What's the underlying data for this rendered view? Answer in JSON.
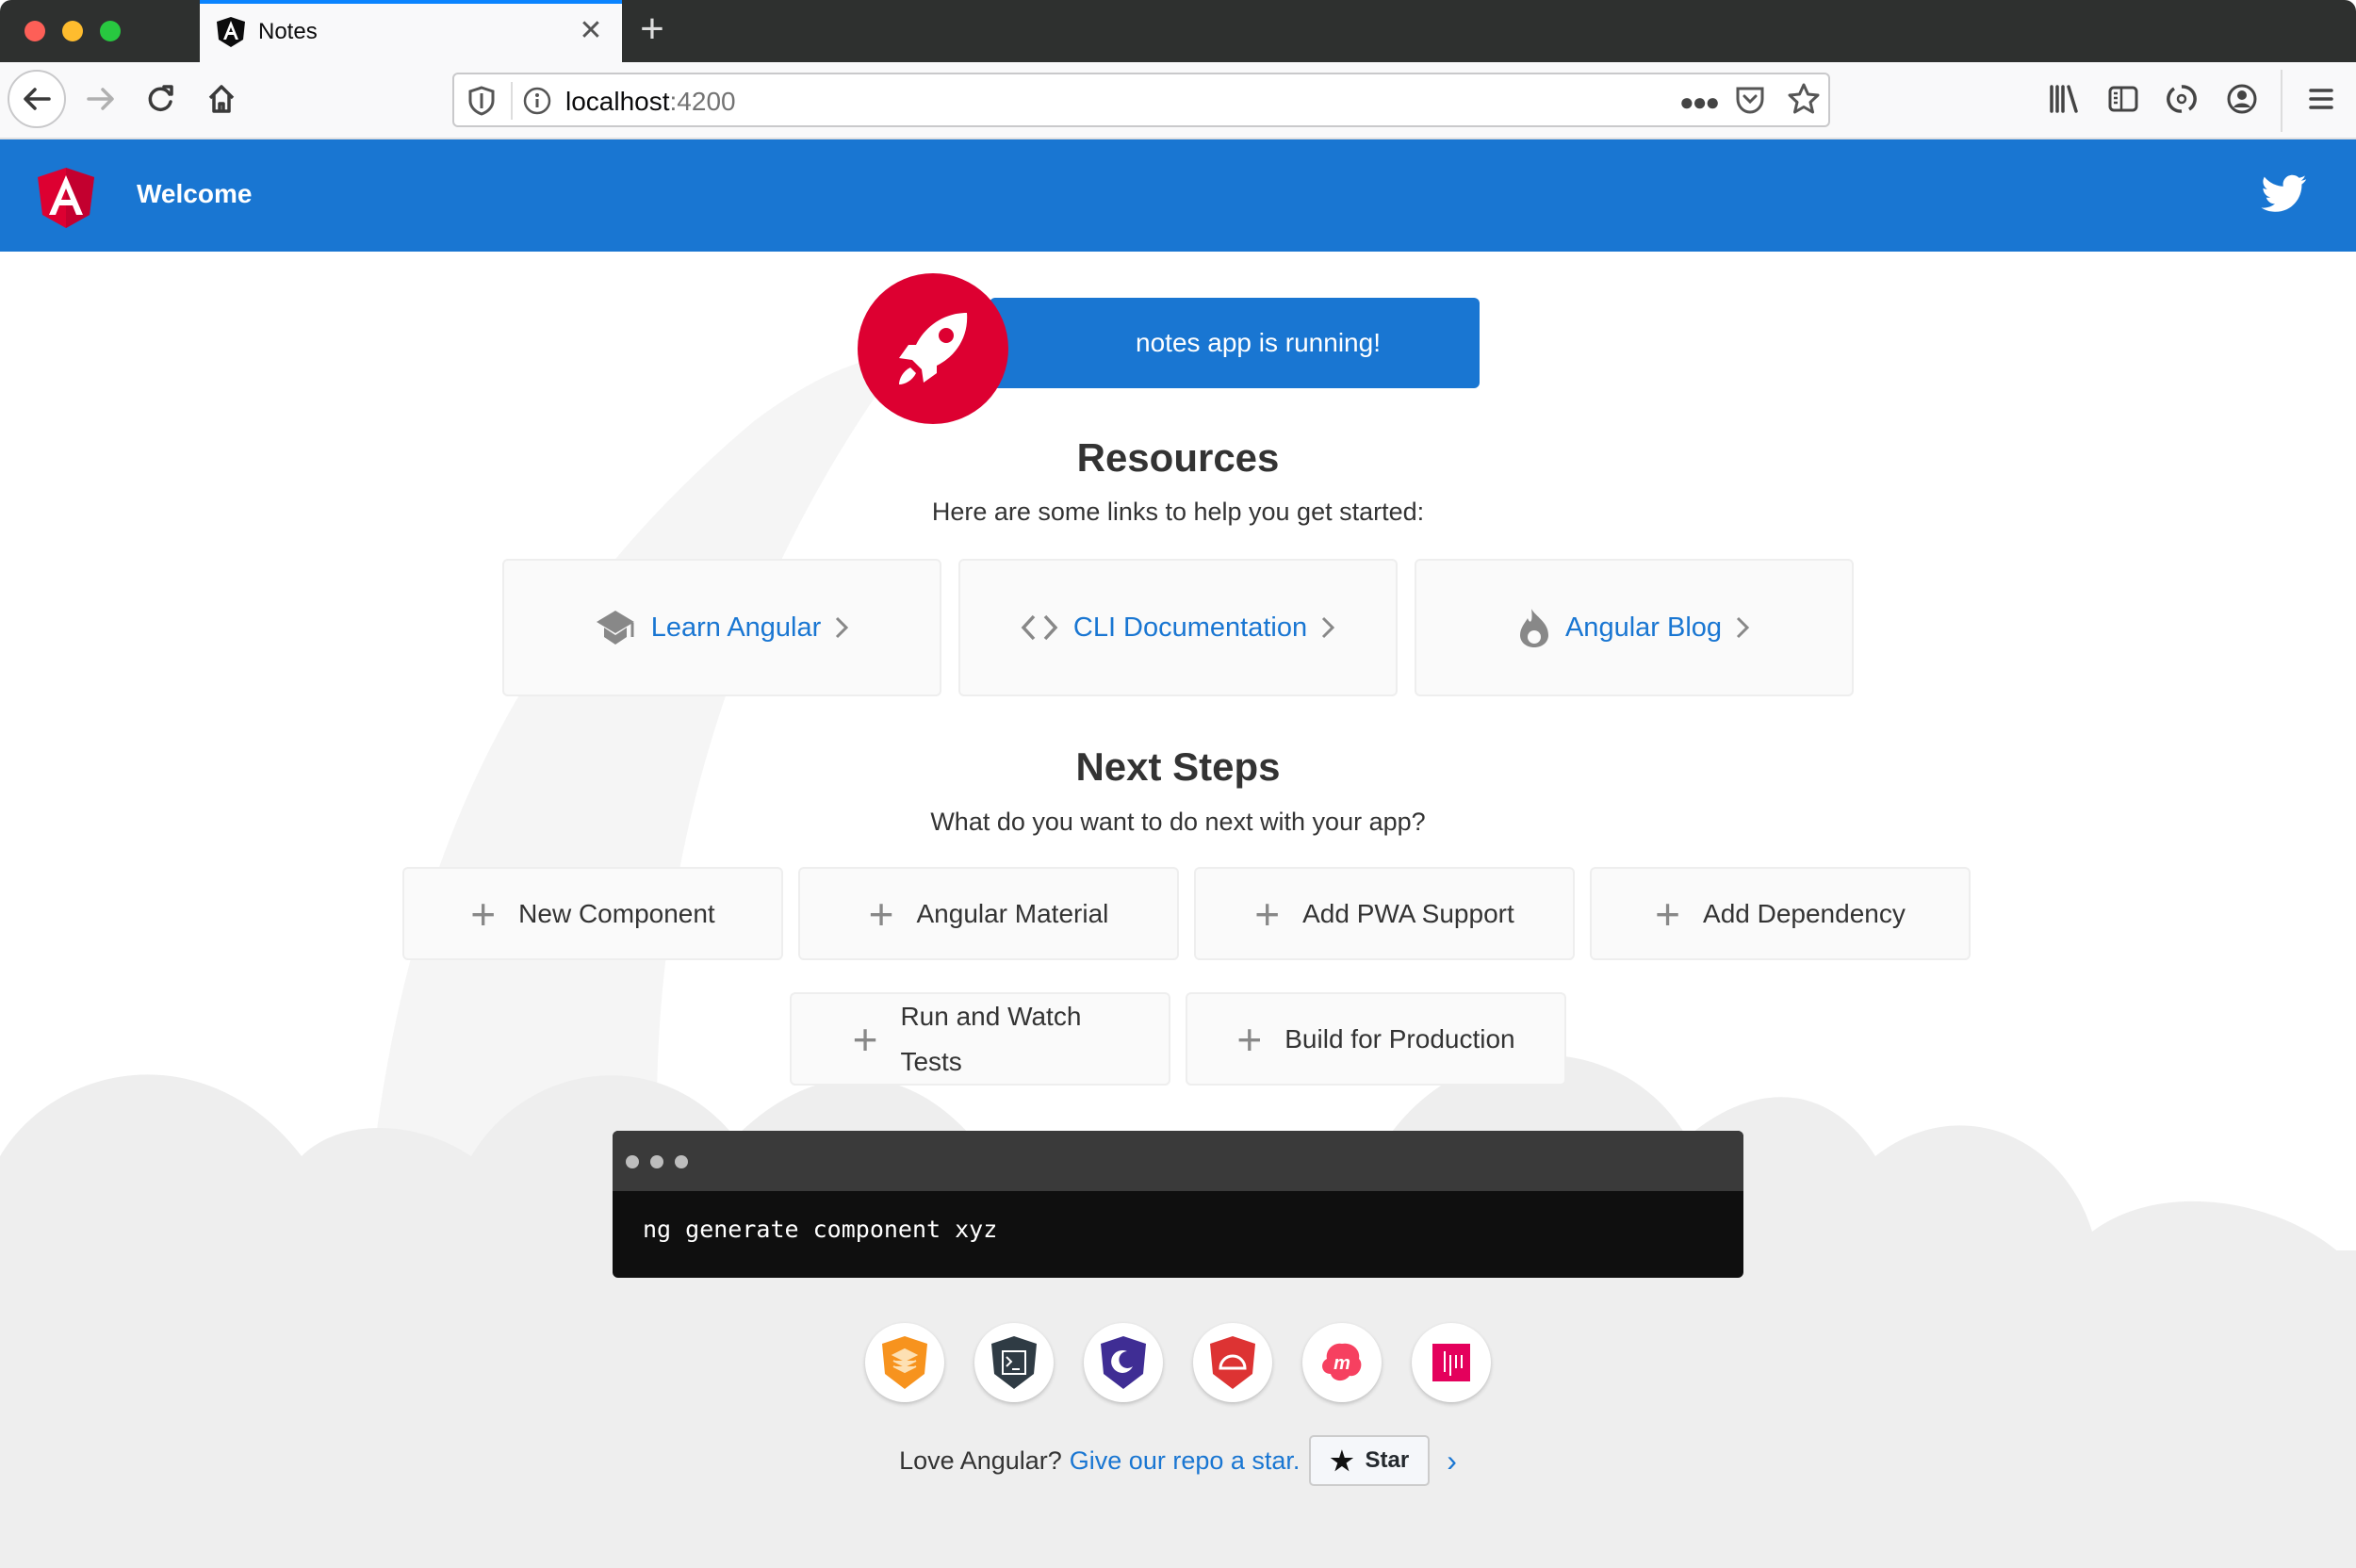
{
  "browser": {
    "tab": {
      "title": "Notes",
      "favicon": "angular-logo-icon",
      "close_icon": "close-icon"
    },
    "new_tab_icon": "plus-icon",
    "toolbar": {
      "back_icon": "arrow-left-icon",
      "forward_icon": "arrow-right-icon",
      "reload_icon": "reload-icon",
      "home_icon": "home-icon",
      "url_host": "localhost",
      "url_port": ":4200",
      "page_actions_icon": "more-icon",
      "pocket_icon": "pocket-icon",
      "bookmark_icon": "star-icon",
      "right_icons": [
        "library-icon",
        "sidebar-icon",
        "sync-icon",
        "account-icon",
        "menu-icon"
      ]
    }
  },
  "header": {
    "title": "Welcome",
    "logo": "angular-logo-icon",
    "twitter_icon": "twitter-icon"
  },
  "banner": {
    "text": "notes app is running!",
    "icon": "rocket-icon"
  },
  "resources": {
    "title": "Resources",
    "subtitle": "Here are some links to help you get started:",
    "cards": [
      {
        "label": "Learn Angular",
        "icon": "graduation-cap-icon"
      },
      {
        "label": "CLI Documentation",
        "icon": "code-icon"
      },
      {
        "label": "Angular Blog",
        "icon": "flame-icon"
      }
    ]
  },
  "next_steps": {
    "title": "Next Steps",
    "subtitle": "What do you want to do next with your app?",
    "cards": [
      {
        "label": "New Component"
      },
      {
        "label": "Angular Material"
      },
      {
        "label": "Add PWA Support"
      },
      {
        "label": "Add Dependency"
      },
      {
        "label": "Run and Watch Tests"
      },
      {
        "label": "Build for Production"
      }
    ]
  },
  "terminal": {
    "command": "ng generate component xyz"
  },
  "ecosystem_links": [
    {
      "name": "animations-icon",
      "color": "#f7931e"
    },
    {
      "name": "cli-icon",
      "color": "#2f3b44"
    },
    {
      "name": "augury-icon",
      "color": "#3f2d94"
    },
    {
      "name": "protractor-icon",
      "color": "#dd3333"
    },
    {
      "name": "meetup-icon",
      "color": "#f64060"
    },
    {
      "name": "discord-icon",
      "color": "#e4005c"
    }
  ],
  "footer": {
    "text": "Love Angular?",
    "link": "Give our repo a star.",
    "star_button": "Star"
  },
  "colors": {
    "primary": "#1976d2",
    "angular_red": "#dd0031",
    "link": "#1976d2"
  }
}
